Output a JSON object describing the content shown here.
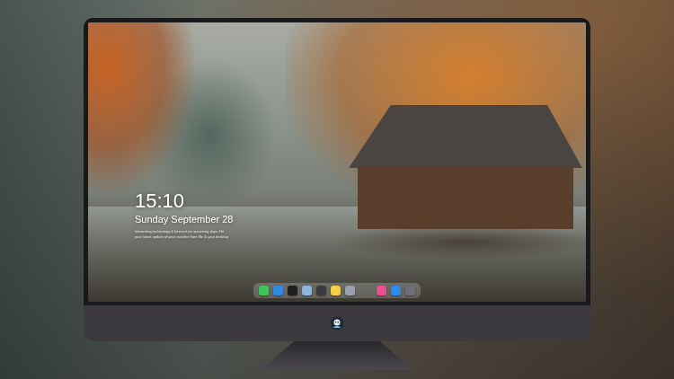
{
  "lock_screen": {
    "time": "15:10",
    "date": "Sunday September 28",
    "note": [
      "Interesting technology & forecast on upcoming days. Hit",
      "your latest update of your weather from Me & your desktop"
    ]
  },
  "dock": {
    "apps": [
      {
        "color": "#3fc35b"
      },
      {
        "color": "#2f8be6"
      },
      {
        "color": "#1e1e22"
      },
      {
        "color": "#8fb6d9"
      },
      {
        "color": "#3a3a40"
      },
      {
        "color": "#f2d04a"
      },
      {
        "color": "#9aa3ad"
      }
    ],
    "pinned": [
      {
        "color": "#e9508f"
      },
      {
        "color": "#2d8cf0"
      },
      {
        "color": "#6b6f78"
      }
    ]
  }
}
